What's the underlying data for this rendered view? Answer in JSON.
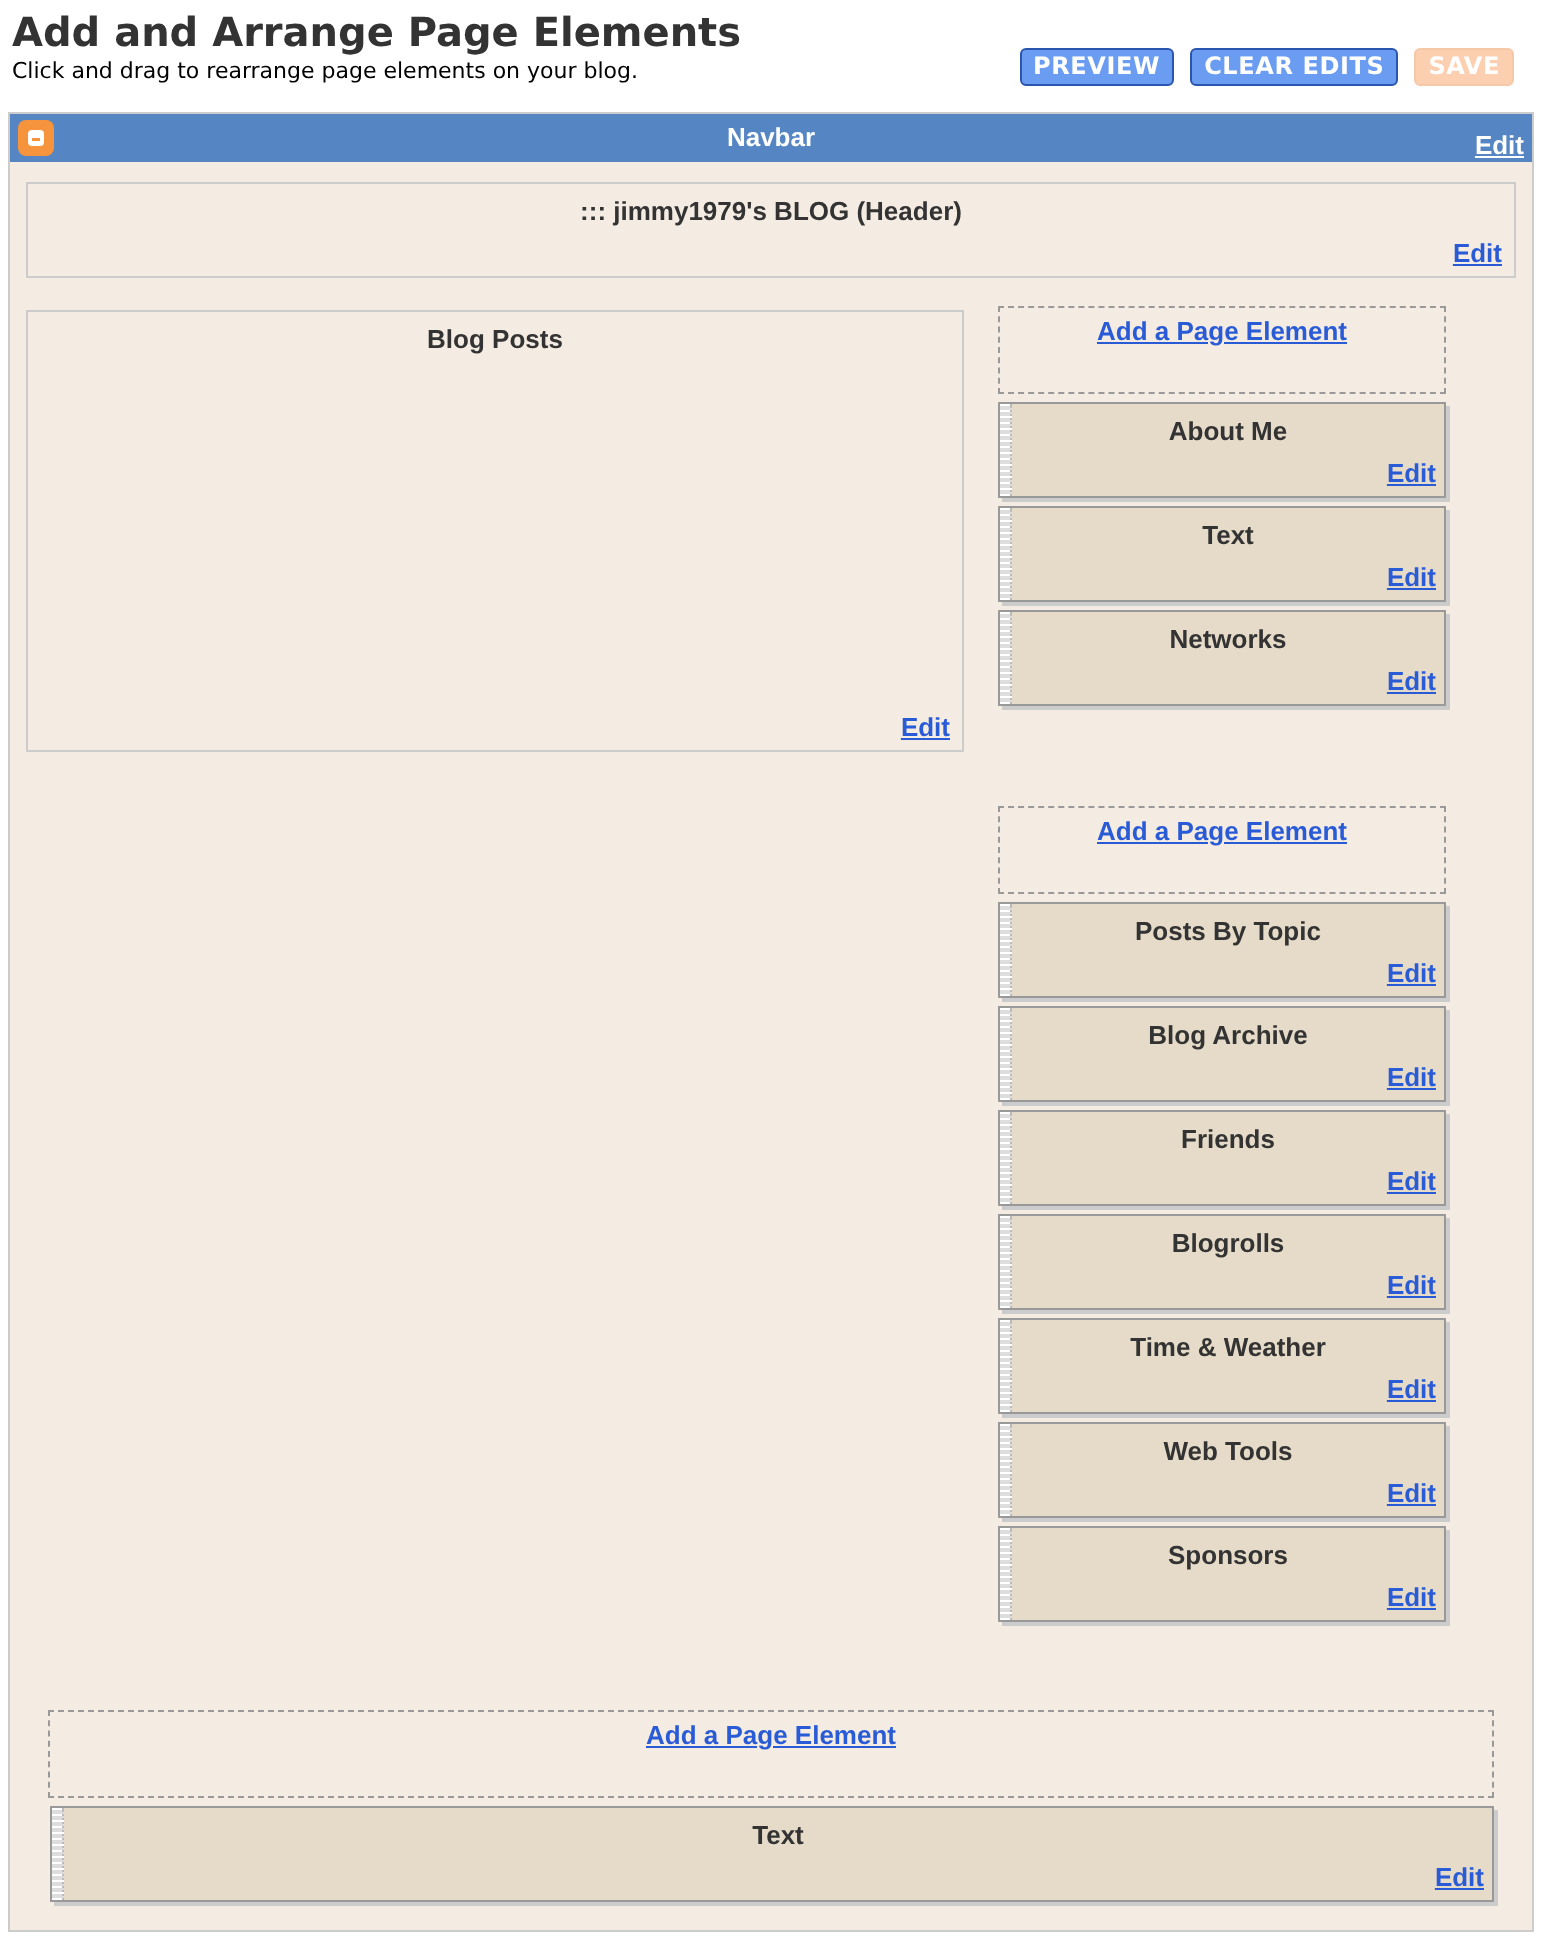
{
  "page": {
    "title": "Add and Arrange Page Elements",
    "subtitle": "Click and drag to rearrange page elements on your blog."
  },
  "buttons": [
    {
      "label": "PREVIEW",
      "disabled": false
    },
    {
      "label": "CLEAR EDITS",
      "disabled": false
    },
    {
      "label": "SAVE",
      "disabled": true
    }
  ],
  "navbar": {
    "title": "Navbar",
    "edit": "Edit"
  },
  "header": {
    "title": "::: jimmy1979's BLOG (Header)",
    "edit": "Edit"
  },
  "main": {
    "title": "Blog Posts",
    "edit": "Edit"
  },
  "sidebar": [
    {
      "add_link": "Add a Page Element",
      "widgets": [
        {
          "title": "About Me",
          "edit": "Edit"
        },
        {
          "title": "Text",
          "edit": "Edit"
        },
        {
          "title": "Networks",
          "edit": "Edit"
        }
      ]
    },
    {
      "add_link": "Add a Page Element",
      "widgets": [
        {
          "title": "Posts By Topic",
          "edit": "Edit"
        },
        {
          "title": "Blog Archive",
          "edit": "Edit"
        },
        {
          "title": "Friends",
          "edit": "Edit"
        },
        {
          "title": "Blogrolls",
          "edit": "Edit"
        },
        {
          "title": "Time & Weather",
          "edit": "Edit"
        },
        {
          "title": "Web Tools",
          "edit": "Edit"
        },
        {
          "title": "Sponsors",
          "edit": "Edit"
        }
      ]
    }
  ],
  "footer": {
    "add_link": "Add a Page Element",
    "widgets": [
      {
        "title": "Text",
        "edit": "Edit"
      }
    ]
  }
}
